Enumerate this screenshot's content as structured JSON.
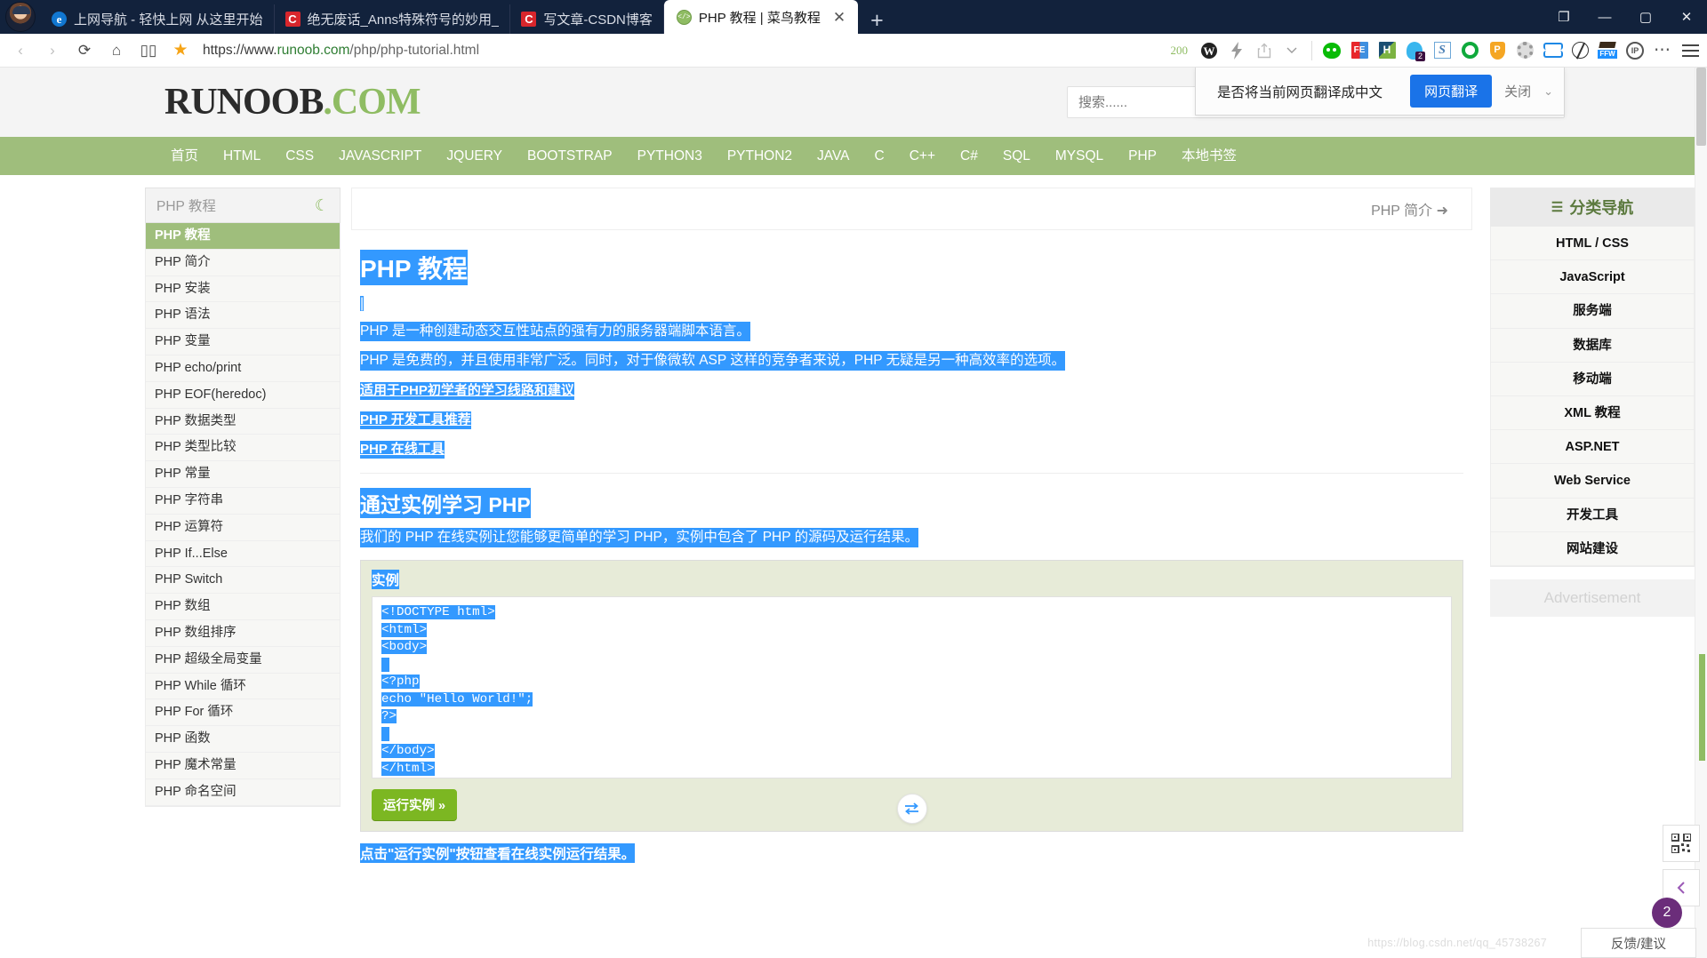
{
  "browser": {
    "tabs": [
      {
        "title": "上网导航 - 轻快上网 从这里开始",
        "favicon": "edge-e-icon",
        "active": false
      },
      {
        "title": "绝无废话_Anns特殊符号的妙用_",
        "favicon": "csdn-c-icon",
        "active": false
      },
      {
        "title": "写文章-CSDN博客",
        "favicon": "csdn-c-icon",
        "active": false
      },
      {
        "title": "PHP 教程 | 菜鸟教程",
        "favicon": "runoob-icon",
        "active": true
      }
    ],
    "new_tab_label": "+",
    "tab_close_label": "✕",
    "window_controls": {
      "restore": "❐",
      "minimize": "—",
      "maximize": "▢",
      "close": "✕"
    },
    "toolbar": {
      "back": "‹",
      "forward": "›",
      "reload": "⟳",
      "home": "⌂",
      "reading_view": "▯▯",
      "favorite": "★",
      "url_scheme": "https://www.",
      "url_domain": "runoob.com",
      "url_path": "/php/php-tutorial.html",
      "status_code": "200",
      "wordpress_icon": "wordpress-icon",
      "bolt_icon": "lightning-icon",
      "share_icon": "share-icon",
      "chevron_icon": "chevron-down-icon",
      "dots_icon": "⋯",
      "menu_icon": "hamburger-menu-icon",
      "extensions": [
        "wechat-icon",
        "fe-icon",
        "h-icon",
        "qq-icon",
        "sogou-icon",
        "green-gear-icon",
        "shield-p-icon",
        "gray-gear-icon",
        "sync-icon",
        "globe-icon",
        "ffw-icon",
        "ip-search-icon"
      ]
    }
  },
  "translate_popup": {
    "message": "是否将当前网页翻译成中文",
    "primary_button": "网页翻译",
    "close_label": "关闭",
    "caret": "⌄",
    "primary_color": "#1a73e8"
  },
  "site": {
    "logo_dark": "RUNOOB",
    "logo_green": ".COM",
    "search_placeholder": "搜索......",
    "nav": [
      "首页",
      "HTML",
      "CSS",
      "JAVASCRIPT",
      "JQUERY",
      "BOOTSTRAP",
      "PYTHON3",
      "PYTHON2",
      "JAVA",
      "C",
      "C++",
      "C#",
      "SQL",
      "MYSQL",
      "PHP",
      "本地书签"
    ],
    "nav_bg": "#9fbe7c"
  },
  "left_sidebar": {
    "search_placeholder": "PHP 教程",
    "moon_icon": "☾",
    "items": [
      "PHP 教程",
      "PHP 简介",
      "PHP 安装",
      "PHP 语法",
      "PHP 变量",
      "PHP echo/print",
      "PHP EOF(heredoc)",
      "PHP 数据类型",
      "PHP 类型比较",
      "PHP 常量",
      "PHP 字符串",
      "PHP 运算符",
      "PHP If...Else",
      "PHP Switch",
      "PHP 数组",
      "PHP 数组排序",
      "PHP 超级全局变量",
      "PHP While 循环",
      "PHP For 循环",
      "PHP 函数",
      "PHP 魔术常量",
      "PHP 命名空间"
    ],
    "active_index": 0
  },
  "main": {
    "breadcrumb_next": "PHP 简介 ➜",
    "h1": "PHP 教程",
    "cursor_marker": "|",
    "paragraphs": [
      "PHP 是一种创建动态交互性站点的强有力的服务器端脚本语言。",
      "PHP 是免费的，并且使用非常广泛。同时，对于像微软 ASP 这样的竞争者来说，PHP 无疑是另一种高效率的选项。"
    ],
    "links": [
      "适用于PHP初学者的学习线路和建议",
      "PHP 开发工具推荐",
      "PHP 在线工具"
    ],
    "h2": "通过实例学习 PHP",
    "intro2": "我们的 PHP 在线实例让您能够更简单的学习 PHP，实例中包含了 PHP 的源码及运行结果。",
    "example_title": "实例",
    "code_lines": [
      "<!DOCTYPE html>",
      "<html>",
      "<body>",
      "",
      "<?php",
      "echo \"Hello World!\";",
      "?>",
      "",
      "</body>",
      "</html>",
      ""
    ],
    "run_button": "运行实例 »",
    "swap_icon": "⇄",
    "after_note": "点击\"运行实例\"按钮查看在线实例运行结果。",
    "selection_color": "#3399ff"
  },
  "right_sidebar": {
    "title": "分类导航",
    "list_icon": "☰",
    "items": [
      "HTML / CSS",
      "JavaScript",
      "服务端",
      "数据库",
      "移动端",
      "XML 教程",
      "ASP.NET",
      "Web Service",
      "开发工具",
      "网站建设"
    ],
    "ad_label": "Advertisement"
  },
  "floating": {
    "qr_icon": "qr-code-icon",
    "back_to_top": "‹",
    "badge_count": "2",
    "feedback_label": "反馈/建议",
    "watermark": "https://blog.csdn.net/qq_45738267"
  }
}
